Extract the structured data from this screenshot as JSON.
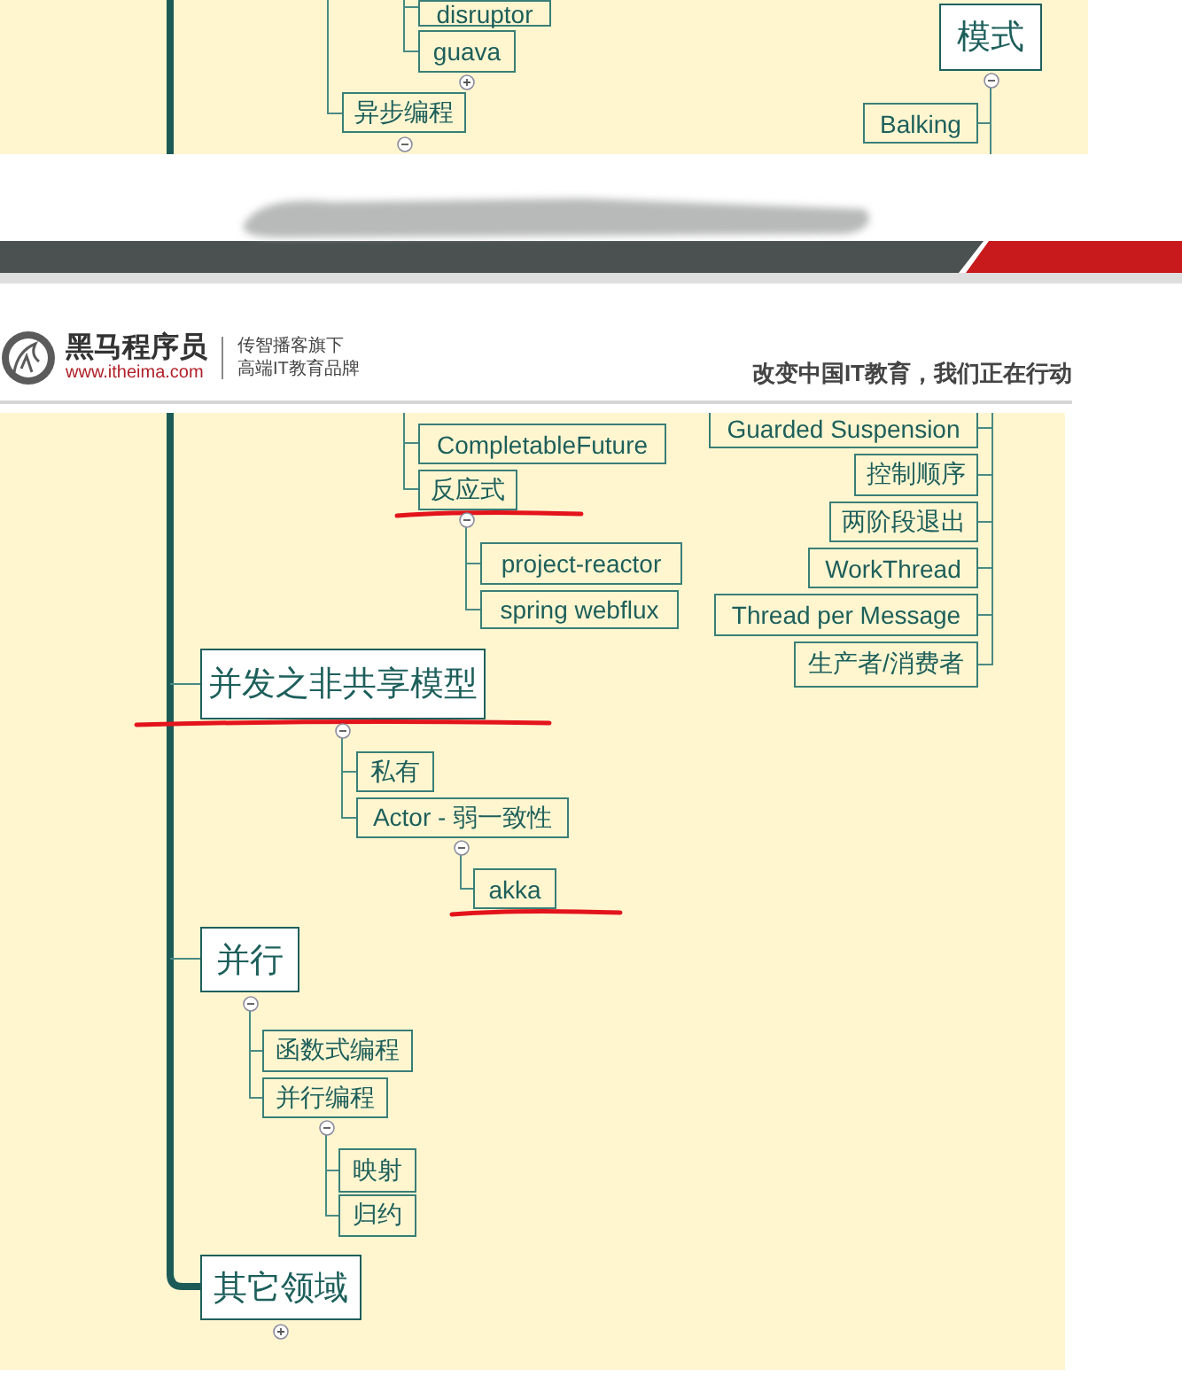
{
  "top_slide": {
    "nodes": [
      {
        "text": "disruptor",
        "kind": "sub"
      },
      {
        "text": "guava",
        "kind": "sub",
        "expanded": false
      },
      {
        "text": "异步编程",
        "kind": "sub",
        "expanded": true
      },
      {
        "text": "模式",
        "kind": "main",
        "expanded": true,
        "children": [
          {
            "text": "Balking",
            "kind": "sub"
          }
        ]
      }
    ]
  },
  "header": {
    "brand": "黑马程序员",
    "url": "www.itheima.com",
    "tagline_lines": [
      "传智播客旗下",
      "高端IT教育品牌"
    ],
    "slogan": "改变中国IT教育，我们正在行动"
  },
  "bottom_slide": {
    "nodes": [
      {
        "text": "CompletableFuture",
        "kind": "sub"
      },
      {
        "text": "反应式",
        "kind": "sub",
        "expanded": true,
        "underlined": true,
        "children": [
          {
            "text": "project-reactor",
            "kind": "sub"
          },
          {
            "text": "spring webflux",
            "kind": "sub"
          }
        ]
      },
      {
        "text": "Guarded Suspension",
        "kind": "sub"
      },
      {
        "text": "控制顺序",
        "kind": "sub"
      },
      {
        "text": "两阶段退出",
        "kind": "sub"
      },
      {
        "text": "WorkThread",
        "kind": "sub"
      },
      {
        "text": "Thread per Message",
        "kind": "sub"
      },
      {
        "text": "生产者/消费者",
        "kind": "sub"
      },
      {
        "text": "并发之非共享模型",
        "kind": "main",
        "expanded": true,
        "underlined": true,
        "children": [
          {
            "text": "私有",
            "kind": "sub"
          },
          {
            "text": "Actor - 弱一致性",
            "kind": "sub",
            "expanded": true,
            "children": [
              {
                "text": "akka",
                "kind": "sub",
                "underlined": true
              }
            ]
          }
        ]
      },
      {
        "text": "并行",
        "kind": "main",
        "expanded": true,
        "children": [
          {
            "text": "函数式编程",
            "kind": "sub"
          },
          {
            "text": "并行编程",
            "kind": "sub",
            "expanded": true,
            "children": [
              {
                "text": "映射",
                "kind": "sub"
              },
              {
                "text": "归约",
                "kind": "sub"
              }
            ]
          }
        ]
      },
      {
        "text": "其它领域",
        "kind": "main",
        "expanded": false
      }
    ]
  }
}
